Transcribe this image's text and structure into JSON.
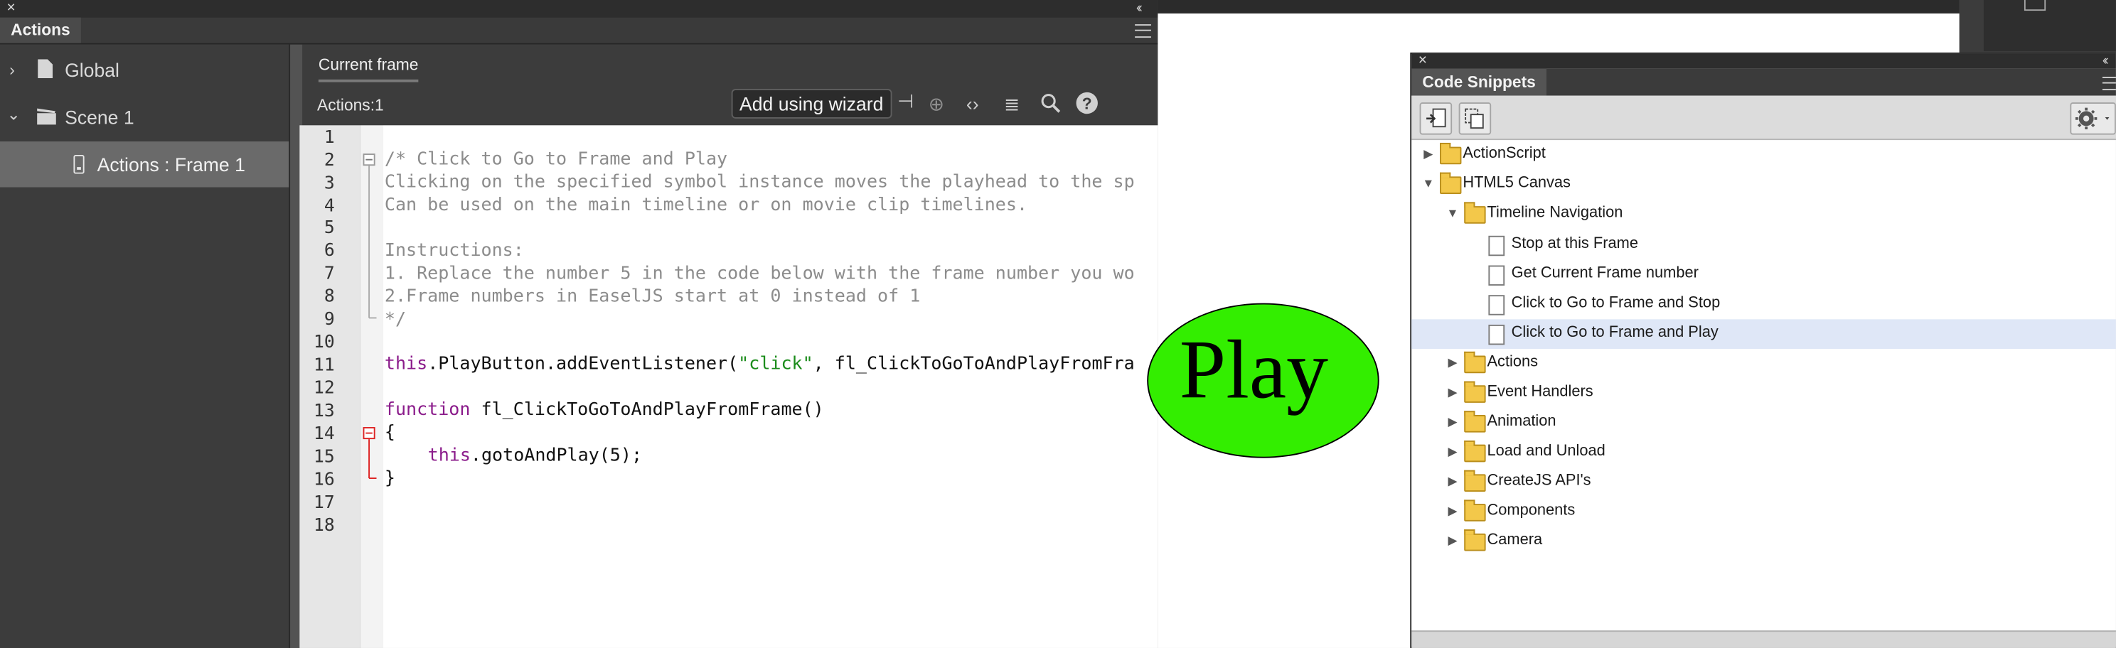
{
  "actions_panel": {
    "title": "Actions",
    "tree": {
      "items": [
        {
          "label": "Global"
        },
        {
          "label": "Scene 1"
        },
        {
          "label": "Actions : Frame 1"
        }
      ]
    },
    "editor": {
      "tab_label": "Current frame",
      "script_label": "Actions:1",
      "wizard_button": "Add using wizard",
      "line_numbers": [
        "1",
        "2",
        "3",
        "4",
        "5",
        "6",
        "7",
        "8",
        "9",
        "10",
        "11",
        "12",
        "13",
        "14",
        "15",
        "16",
        "17",
        "18"
      ],
      "code": {
        "l2": "/* Click to Go to Frame and Play",
        "l3": "Clicking on the specified symbol instance moves the playhead to the sp",
        "l4": "Can be used on the main timeline or on movie clip timelines.",
        "l6": "Instructions:",
        "l7": "1. Replace the number 5 in the code below with the frame number you wo",
        "l8": "2.Frame numbers in EaselJS start at 0 instead of 1",
        "l9": "*/",
        "l11_kw": "this",
        "l11_a": ".PlayButton.addEventListener(",
        "l11_str": "\"click\"",
        "l11_b": ", fl_ClickToGoToAndPlayFromFra",
        "l13_kw": "function",
        "l13_rest": " fl_ClickToGoToAndPlayFromFrame()",
        "l14": "{",
        "l15_kw": "this",
        "l15_rest": ".gotoAndPlay(5);",
        "l16": "}"
      }
    }
  },
  "stage": {
    "button_text": "Play"
  },
  "code_snippets": {
    "title": "Code Snippets",
    "items": [
      {
        "label": "ActionScript"
      },
      {
        "label": "HTML5 Canvas"
      },
      {
        "label": "Timeline Navigation"
      },
      {
        "label": "Stop at this Frame"
      },
      {
        "label": "Get Current Frame number"
      },
      {
        "label": "Click to Go to Frame and Stop"
      },
      {
        "label": "Click to Go to Frame and Play"
      },
      {
        "label": "Actions"
      },
      {
        "label": "Event Handlers"
      },
      {
        "label": "Animation"
      },
      {
        "label": "Load and Unload"
      },
      {
        "label": "CreateJS API's"
      },
      {
        "label": "Components"
      },
      {
        "label": "Camera"
      }
    ]
  },
  "icons": {
    "close": "×",
    "collapse": "‹‹",
    "chevron_right": "›",
    "chevron_down": "⌄"
  }
}
